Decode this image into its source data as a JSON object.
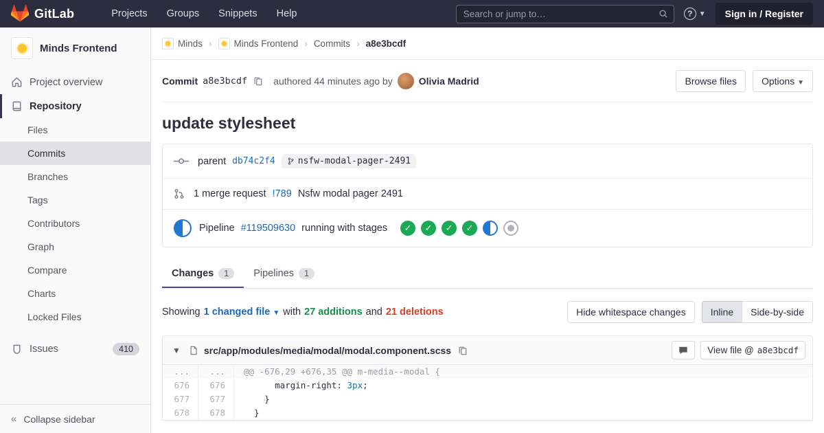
{
  "navbar": {
    "logo": "GitLab",
    "menu": [
      {
        "label": "Projects"
      },
      {
        "label": "Groups"
      },
      {
        "label": "Snippets"
      },
      {
        "label": "Help"
      }
    ],
    "search": {
      "placeholder": "Search or jump to…"
    },
    "sign_in_label": "Sign in / Register"
  },
  "sidebar": {
    "project": {
      "name": "Minds Frontend"
    },
    "overview_label": "Project overview",
    "repository_label": "Repository",
    "repo_items": [
      {
        "label": "Files"
      },
      {
        "label": "Commits"
      },
      {
        "label": "Branches"
      },
      {
        "label": "Tags"
      },
      {
        "label": "Contributors"
      },
      {
        "label": "Graph"
      },
      {
        "label": "Compare"
      },
      {
        "label": "Charts"
      },
      {
        "label": "Locked Files"
      }
    ],
    "issues": {
      "label": "Issues",
      "count": "410"
    },
    "collapse_label": "Collapse sidebar"
  },
  "breadcrumb": {
    "items": [
      {
        "label": "Minds"
      },
      {
        "label": "Minds Frontend"
      },
      {
        "label": "Commits"
      },
      {
        "label": "a8e3bcdf"
      }
    ]
  },
  "commit_header": {
    "commit_label": "Commit",
    "sha": "a8e3bcdf",
    "authored_text": "authored 44 minutes ago by",
    "author_name": "Olivia Madrid",
    "browse_files_label": "Browse files",
    "options_label": "Options"
  },
  "commit": {
    "title": "update stylesheet",
    "parent_label": "parent",
    "parent_sha": "db74c2f4",
    "branch_name": "nsfw-modal-pager-2491",
    "mr_count_text": "1 merge request",
    "mr_ref": "!789",
    "mr_title": "Nsfw modal pager 2491",
    "pipeline_label": "Pipeline",
    "pipeline_id": "#119509630",
    "pipeline_status_text": "running with stages",
    "stages": [
      "success",
      "success",
      "success",
      "success",
      "running",
      "created"
    ]
  },
  "tabs": {
    "changes": {
      "label": "Changes",
      "count": "1"
    },
    "pipelines": {
      "label": "Pipelines",
      "count": "1"
    }
  },
  "diff_summary": {
    "showing_text": "Showing",
    "changed_files_label": "1 changed file",
    "with_text": "with",
    "additions_label": "27 additions",
    "and_text": "and",
    "deletions_label": "21 deletions",
    "hide_whitespace_label": "Hide whitespace changes",
    "inline_label": "Inline",
    "side_by_side_label": "Side-by-side"
  },
  "diff_file": {
    "path": "src/app/modules/media/modal/modal.component.scss",
    "view_file_label": "View file @",
    "view_file_sha": "a8e3bcdf",
    "lines": [
      {
        "old": "...",
        "new": "...",
        "text": "@@ -676,29 +676,35 @@ m-media--modal {"
      },
      {
        "old": "676",
        "new": "676",
        "pre": "      margin-right: ",
        "num": "3px",
        "post": ";"
      },
      {
        "old": "677",
        "new": "677",
        "text": "    }"
      },
      {
        "old": "678",
        "new": "678",
        "text": "  }"
      }
    ]
  },
  "colors": {
    "brand_orange": "#fc6d26",
    "navbar_bg": "#2d2d3f",
    "link_blue": "#1b69b6",
    "success_green": "#1aaa55",
    "running_blue": "#1f78d1",
    "additions_green": "#168f48",
    "deletions_red": "#db3b21",
    "sidebar_bg": "#fafafa",
    "border_gray": "#e5e5e5"
  }
}
